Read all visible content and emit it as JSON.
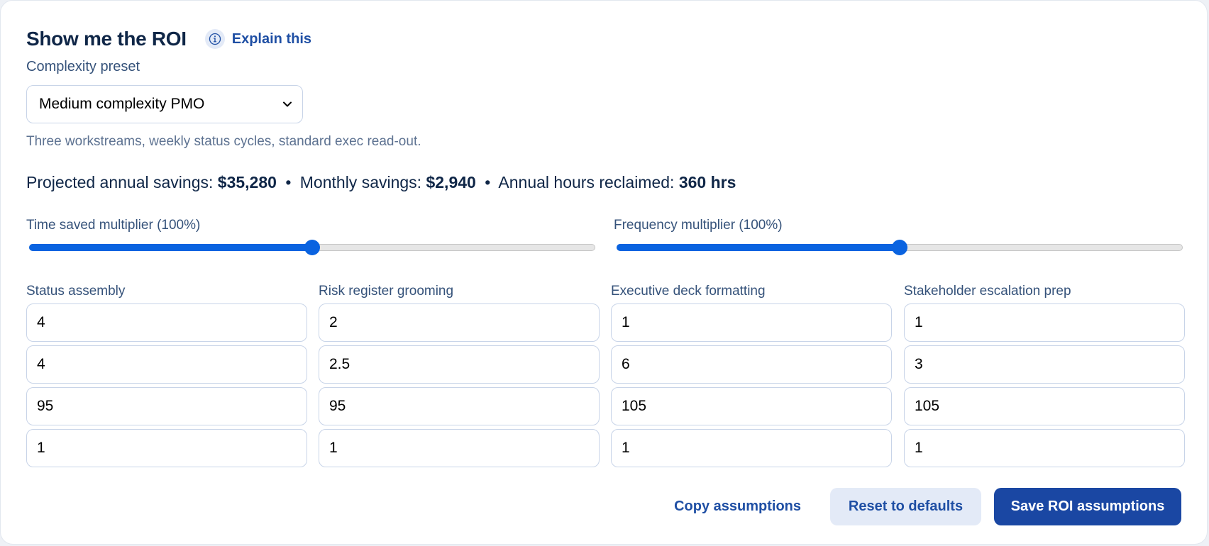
{
  "header": {
    "title": "Show me the ROI",
    "explain_label": "Explain this"
  },
  "preset": {
    "label": "Complexity preset",
    "selected": "Medium complexity PMO",
    "hint": "Three workstreams, weekly status cycles, standard exec read-out."
  },
  "summary": {
    "annual_label": "Projected annual savings:",
    "annual_value": "$35,280",
    "monthly_label": "Monthly savings:",
    "monthly_value": "$2,940",
    "hours_label": "Annual hours reclaimed:",
    "hours_value": "360 hrs",
    "separator": "•"
  },
  "sliders": [
    {
      "label": "Time saved multiplier (100%)",
      "value": 0.5
    },
    {
      "label": "Frequency multiplier (100%)",
      "value": 0.5
    }
  ],
  "tasks": [
    {
      "label": "Status assembly",
      "values": [
        "4",
        "4",
        "95",
        "1"
      ]
    },
    {
      "label": "Risk register grooming",
      "values": [
        "2",
        "2.5",
        "95",
        "1"
      ]
    },
    {
      "label": "Executive deck formatting",
      "values": [
        "1",
        "6",
        "105",
        "1"
      ]
    },
    {
      "label": "Stakeholder escalation prep",
      "values": [
        "1",
        "3",
        "105",
        "1"
      ]
    }
  ],
  "actions": {
    "copy": "Copy assumptions",
    "reset": "Reset to defaults",
    "save": "Save ROI assumptions"
  },
  "colors": {
    "accent": "#0a63e0",
    "primary_button": "#1a47a3",
    "secondary_button": "#e3eaf7",
    "heading": "#0f2647"
  }
}
